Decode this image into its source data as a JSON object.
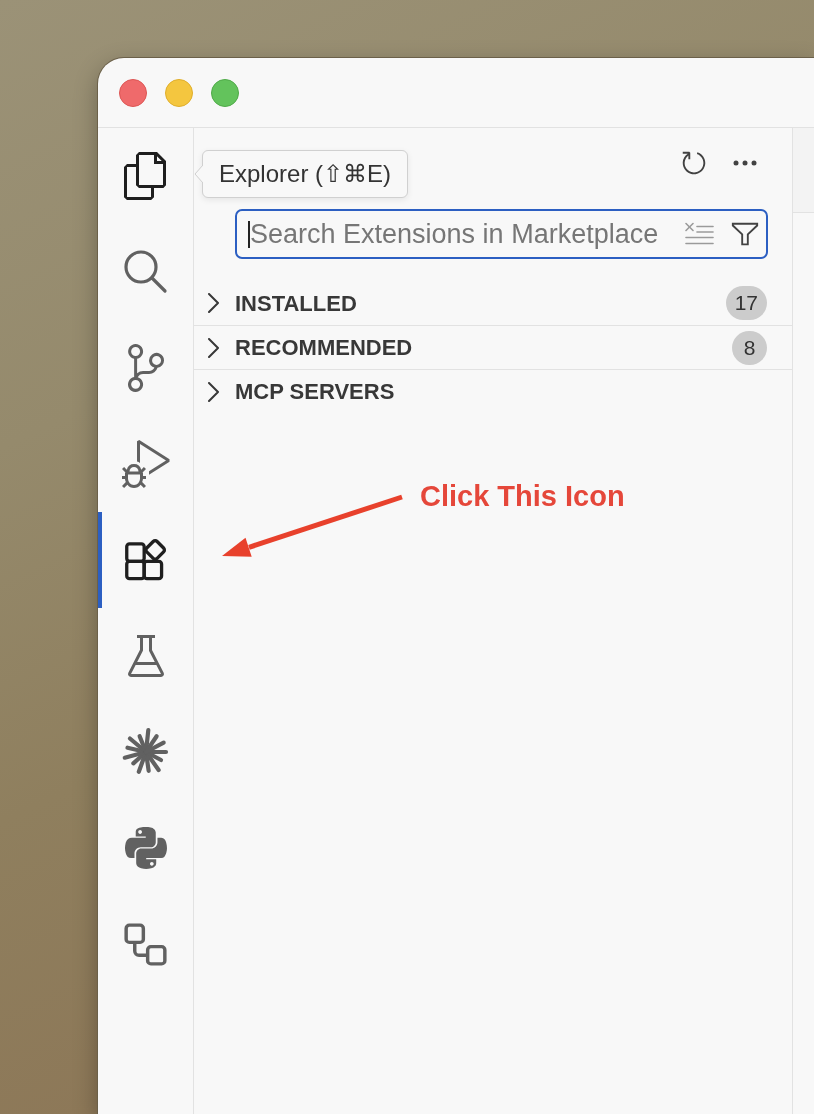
{
  "activity_bar": {
    "items": [
      {
        "kind": "explorer",
        "selected": false,
        "hovered": true
      },
      {
        "kind": "search",
        "selected": false,
        "hovered": false
      },
      {
        "kind": "source_control",
        "selected": false,
        "hovered": false
      },
      {
        "kind": "run_debug",
        "selected": false,
        "hovered": false
      },
      {
        "kind": "extensions",
        "selected": true,
        "hovered": false
      },
      {
        "kind": "testing",
        "selected": false,
        "hovered": false
      },
      {
        "kind": "spark",
        "selected": false,
        "hovered": false
      },
      {
        "kind": "python",
        "selected": false,
        "hovered": false
      },
      {
        "kind": "workflow",
        "selected": false,
        "hovered": false
      }
    ]
  },
  "tooltip": {
    "text": "Explorer (⇧⌘E)"
  },
  "search": {
    "placeholder": "Search Extensions in Marketplace",
    "focused": true
  },
  "sections": [
    {
      "label": "INSTALLED",
      "count": "17",
      "expanded": false
    },
    {
      "label": "RECOMMENDED",
      "count": "8",
      "expanded": false
    },
    {
      "label": "MCP SERVERS",
      "expanded": false
    }
  ],
  "annotation": {
    "text": "Click This Icon"
  }
}
